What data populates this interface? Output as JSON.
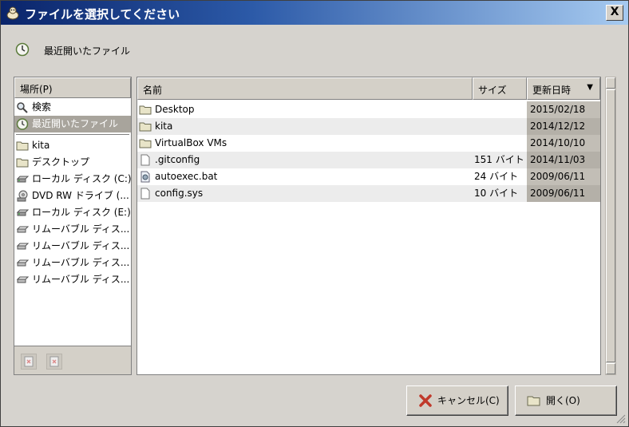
{
  "window": {
    "title": "ファイルを選択してください",
    "close_label": "X"
  },
  "header": {
    "label": "最近開いたファイル"
  },
  "places": {
    "header": "場所(P)",
    "items": [
      {
        "label": "検索",
        "icon": "search-icon"
      },
      {
        "label": "最近開いたファイル",
        "icon": "recent-icon",
        "selected": true
      },
      {
        "label": "kita",
        "icon": "folder-icon"
      },
      {
        "label": "デスクトップ",
        "icon": "folder-icon"
      },
      {
        "label": "ローカル ディスク (C:)",
        "icon": "harddisk-icon"
      },
      {
        "label": "DVD RW ドライブ (...",
        "icon": "dvd-icon"
      },
      {
        "label": "ローカル ディスク (E:)",
        "icon": "harddisk-icon"
      },
      {
        "label": "リムーバブル ディス...",
        "icon": "removable-icon"
      },
      {
        "label": "リムーバブル ディス...",
        "icon": "removable-icon"
      },
      {
        "label": "リムーバブル ディス...",
        "icon": "removable-icon"
      },
      {
        "label": "リムーバブル ディス...",
        "icon": "removable-icon"
      }
    ]
  },
  "columns": {
    "name": "名前",
    "size": "サイズ",
    "modified": "更新日時",
    "sort_indicator": "▼"
  },
  "files": [
    {
      "name": "Desktop",
      "size": "",
      "modified": "2015/02/18",
      "icon": "folder-icon"
    },
    {
      "name": "kita",
      "size": "",
      "modified": "2014/12/12",
      "icon": "folder-icon"
    },
    {
      "name": "VirtualBox VMs",
      "size": "",
      "modified": "2014/10/10",
      "icon": "folder-icon"
    },
    {
      "name": ".gitconfig",
      "size": "151 バイト",
      "modified": "2014/11/03",
      "icon": "file-icon"
    },
    {
      "name": "autoexec.bat",
      "size": "24 バイト",
      "modified": "2009/06/11",
      "icon": "script-icon"
    },
    {
      "name": "config.sys",
      "size": "10 バイト",
      "modified": "2009/06/11",
      "icon": "file-icon"
    }
  ],
  "buttons": {
    "cancel": "キャンセル(C)",
    "open": "開く(O)"
  }
}
